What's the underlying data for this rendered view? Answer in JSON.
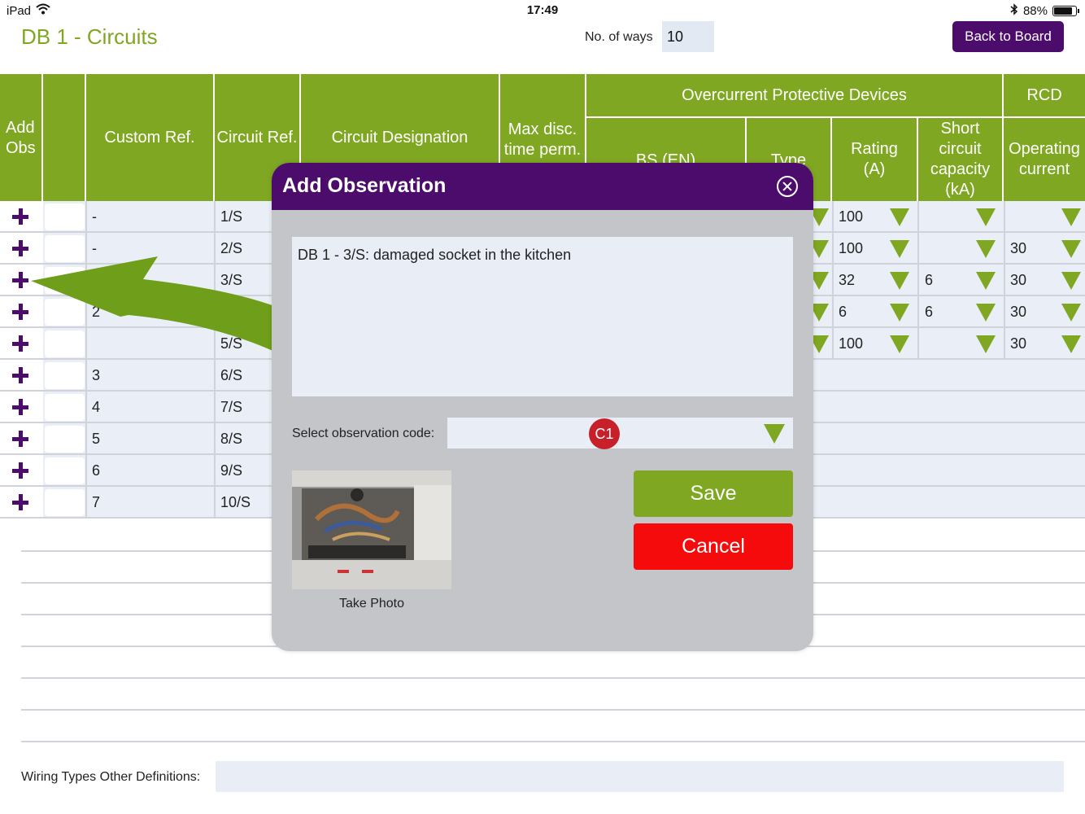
{
  "status_bar": {
    "device": "iPad",
    "time": "17:49",
    "battery": "88%",
    "battery_level": 0.88
  },
  "header": {
    "title": "DB 1  - Circuits",
    "ways_label": "No. of ways",
    "ways_value": "10",
    "back_button": "Back to Board"
  },
  "table": {
    "headers": {
      "add_obs": "Add Obs",
      "custom_ref": "Custom Ref.",
      "circuit_ref": "Circuit Ref.",
      "designation": "Circuit Designation",
      "max_disc": "Max disc. time perm.",
      "ocpd_group": "Overcurrent Protective Devices",
      "bs_en": "BS (EN)",
      "type": "Type",
      "rating": "Rating (A)",
      "short_circuit": "Short circuit capacity (kA)",
      "rcd_group": "RCD",
      "operating_current": "Operating current"
    },
    "rows": [
      {
        "custom": "-",
        "circuit": "1/S",
        "rating": "100",
        "short_circuit": "",
        "operating": ""
      },
      {
        "custom": "-",
        "circuit": "2/S",
        "rating": "100",
        "short_circuit": "",
        "operating": "30"
      },
      {
        "custom": "",
        "circuit": "3/S",
        "rating": "32",
        "short_circuit": "6",
        "operating": "30"
      },
      {
        "custom": "2",
        "circuit": "",
        "rating": "6",
        "short_circuit": "6",
        "operating": "30"
      },
      {
        "custom": "",
        "circuit": "5/S",
        "rating": "100",
        "short_circuit": "",
        "operating": "30"
      },
      {
        "custom": "3",
        "circuit": "6/S"
      },
      {
        "custom": "4",
        "circuit": "7/S"
      },
      {
        "custom": "5",
        "circuit": "8/S"
      },
      {
        "custom": "6",
        "circuit": "9/S"
      },
      {
        "custom": "7",
        "circuit": "10/S"
      }
    ]
  },
  "wiring": {
    "label": "Wiring Types Other Definitions:",
    "value": ""
  },
  "modal": {
    "title": "Add Observation",
    "text": "DB 1 - 3/S:  damaged socket in the kitchen",
    "code_label": "Select observation code:",
    "code_value": "C1",
    "photo_label": "Take Photo",
    "save": "Save",
    "cancel": "Cancel"
  },
  "colors": {
    "green": "#7fa722",
    "purple": "#4b0c6b",
    "red": "#f50b0b",
    "badge": "#c7202a"
  }
}
